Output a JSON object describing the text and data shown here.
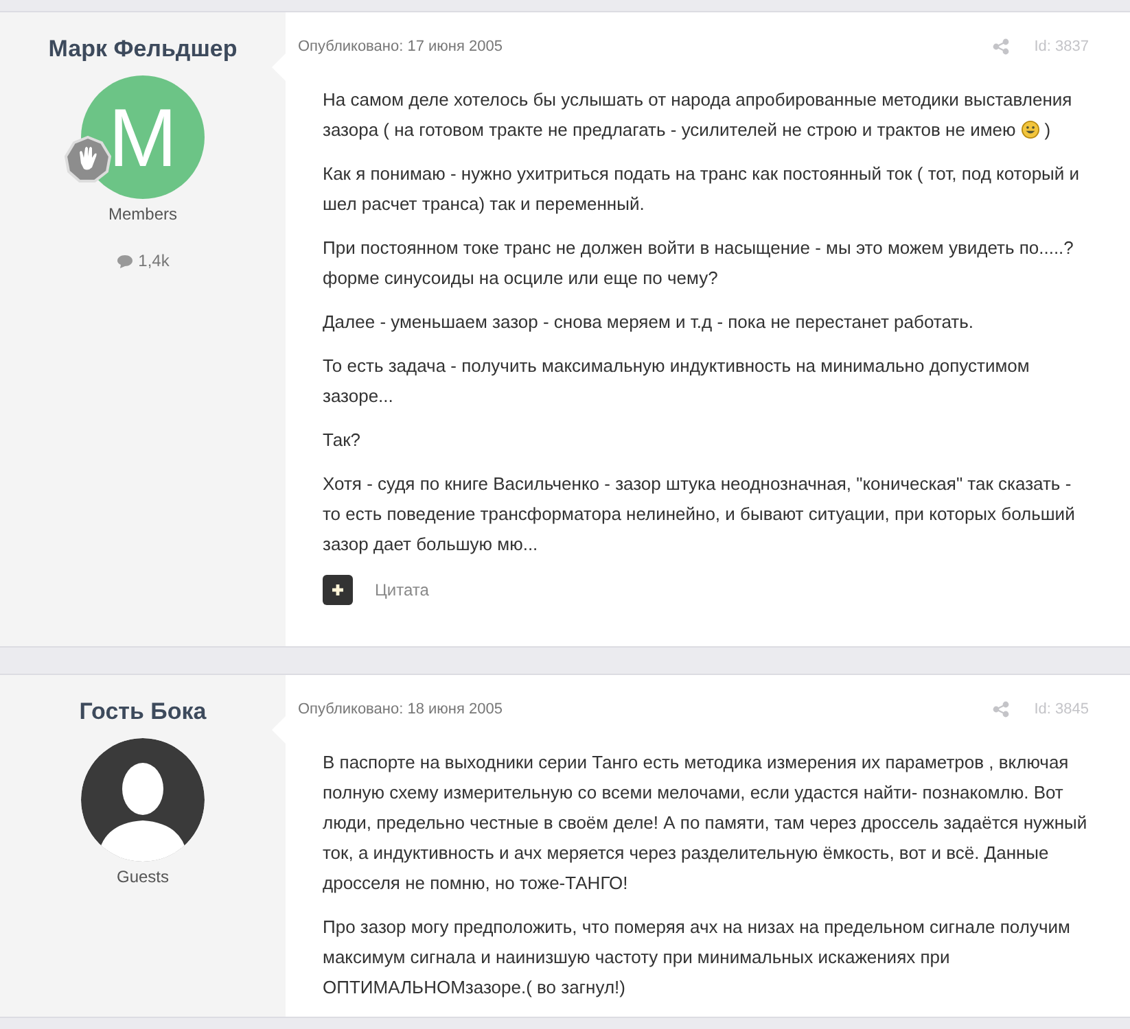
{
  "posts": [
    {
      "author": "Марк Фельдшер",
      "avatar": {
        "kind": "letter",
        "letter": "M",
        "color": "#6cc486"
      },
      "rank_badge": true,
      "group": "Members",
      "reply_count": "1,4k",
      "date": "Опубликовано: 17 июня 2005",
      "post_id": "Id: 3837",
      "paragraphs": [
        {
          "text": "На самом деле хотелось бы услышать от народа апробированные методики выставления зазора ( на готовом тракте не предлагать - усилителей не строю и трактов не имею",
          "emoji": true,
          "tail": ")"
        },
        {
          "text": "Как я понимаю - нужно ухитриться подать на транс как постоянный ток ( тот, под который и шел расчет транса) так и переменный."
        },
        {
          "text": "При постоянном токе транс не должен войти в насыщение - мы это можем увидеть по.....? форме синусоиды на осциле или еще по чему?"
        },
        {
          "text": "Далее - уменьшаем зазор - снова меряем и т.д - пока не перестанет работать."
        },
        {
          "text": "То есть задача - получить максимальную индуктивность на минимально допустимом зазоре..."
        },
        {
          "text": "Так?"
        },
        {
          "text": "Хотя - судя по книге Васильченко - зазор штука неоднозначная, \"коническая\" так сказать - то есть поведение трансформатора нелинейно, и бывают ситуации, при которых больший зазор дает большую мю..."
        }
      ],
      "quote_label": "Цитата"
    },
    {
      "author": "Гость Бока",
      "avatar": {
        "kind": "silhouette"
      },
      "rank_badge": false,
      "group": "Guests",
      "date": "Опубликовано: 18 июня 2005",
      "post_id": "Id: 3845",
      "paragraphs": [
        {
          "text": "В паспорте на выходники серии Танго есть методика измерения их параметров , включая полную схему измерительную со всеми мелочами, если удастся найти- познакомлю. Вот люди, предельно честные в своём деле! А по памяти, там через дроссель задаётся нужный ток, а индуктивность и ачх меряется через разделительную ёмкость, вот и всё. Данные дросселя не помню, но тоже-ТАНГО!"
        },
        {
          "text": "Про зазор могу предположить, что померяя ачх на низах на предельном сигнале получим максимум сигнала и наинизшую частоту при минимальных искажениях при ОПТИМАЛЬНОМзазоре.( во загнул!)"
        }
      ]
    }
  ]
}
